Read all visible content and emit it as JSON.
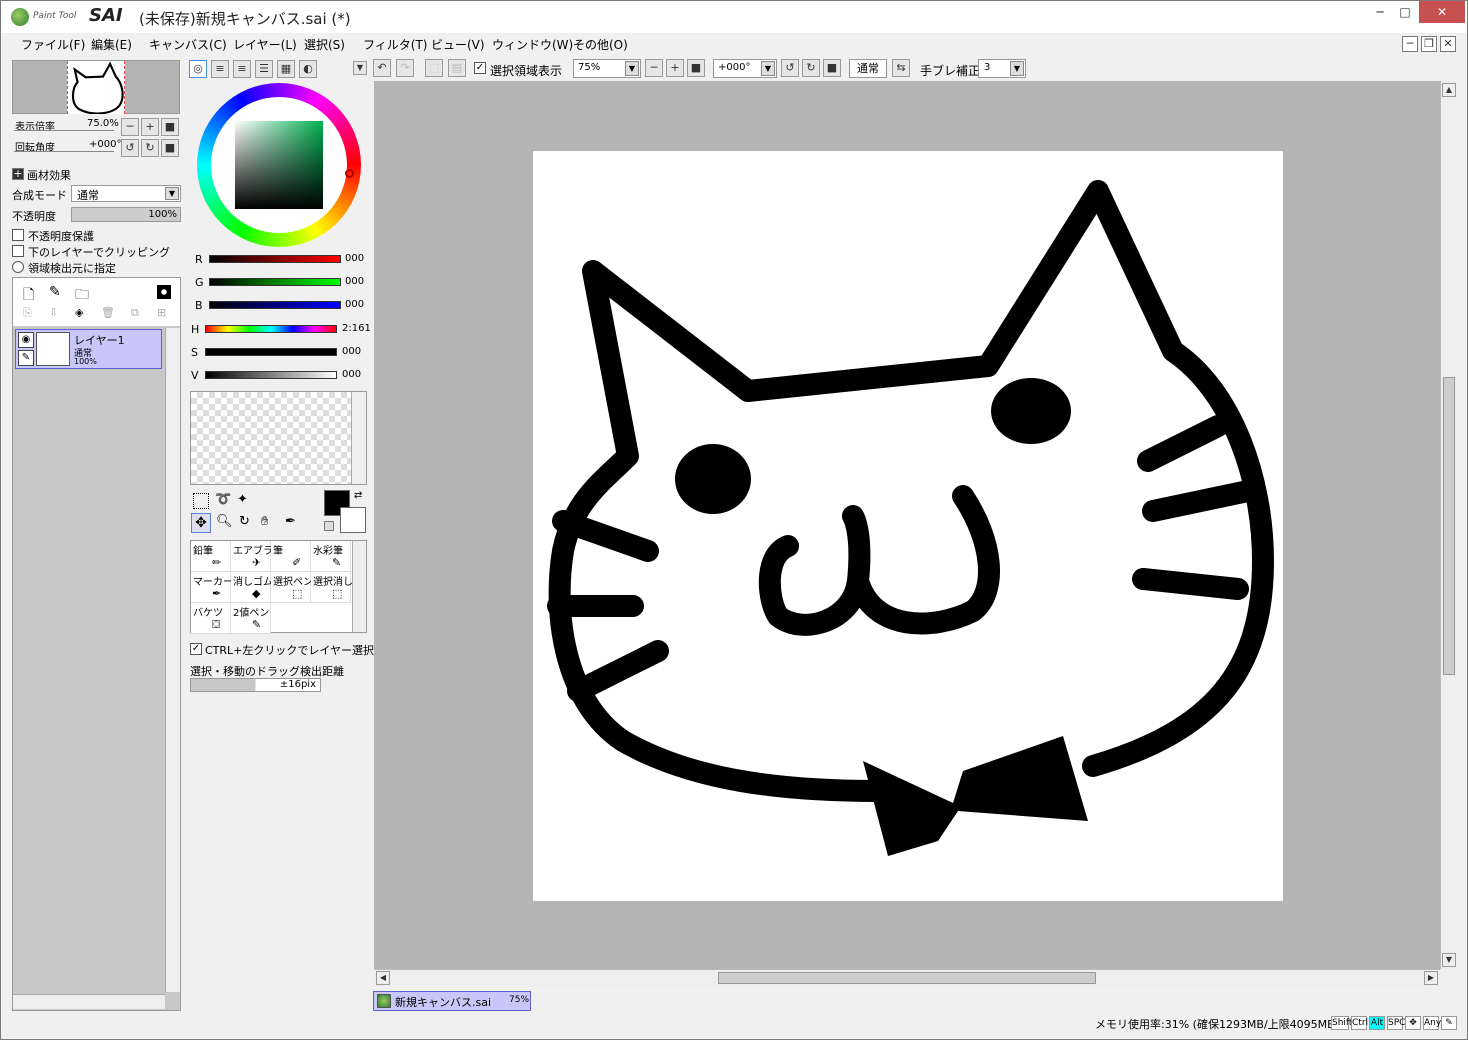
{
  "window": {
    "title": "(未保存)新規キャンバス.sai (*)",
    "logo_small": "Paint Tool",
    "logo_big": "SAI",
    "minimize": "─",
    "maximize": "□",
    "close": "✕"
  },
  "menu": [
    "ファイル(F)",
    "編集(E)",
    "キャンバス(C)",
    "レイヤー(L)",
    "選択(S)",
    "フィルタ(T)",
    "ビュー(V)",
    "ウィンドウ(W)",
    "その他(O)"
  ],
  "navigator": {
    "zoom_label": "表示倍率",
    "zoom_value": "75.0%",
    "rotate_label": "回転角度",
    "rotate_value": "+000°"
  },
  "layer_props": {
    "section": "画材効果",
    "blend_label": "合成モード",
    "blend_value": "通常",
    "opacity_label": "不透明度",
    "opacity_value": "100%",
    "protect_opacity": "不透明度保護",
    "clip_lower": "下のレイヤーでクリッピング",
    "region_source": "領域検出元に指定"
  },
  "layers": [
    {
      "name": "レイヤー1",
      "mode": "通常",
      "opacity": "100%"
    }
  ],
  "color": {
    "rgb": [
      {
        "label": "R",
        "value": "000"
      },
      {
        "label": "G",
        "value": "000"
      },
      {
        "label": "B",
        "value": "000"
      }
    ],
    "hsv": [
      {
        "label": "H",
        "value": "2:161"
      },
      {
        "label": "S",
        "value": "000"
      },
      {
        "label": "V",
        "value": "000"
      }
    ],
    "fg": "#000000",
    "bg": "#ffffff"
  },
  "tools": [
    [
      "鉛筆",
      "エアブラシ",
      "筆",
      "水彩筆"
    ],
    [
      "マーカー",
      "消しゴム",
      "選択ペン",
      "選択消し"
    ],
    [
      "バケツ",
      "2値ペン"
    ]
  ],
  "tool_options": {
    "ctrl_select": "CTRL+左クリックでレイヤー選択",
    "drag_distance_label": "選択・移動のドラッグ検出距離",
    "drag_distance_value": "±16pix"
  },
  "toolbar": {
    "show_selection": "選択領域表示",
    "zoom": "75%",
    "rotation": "+000°",
    "mode": "通常",
    "stabilizer_label": "手ブレ補正",
    "stabilizer_value": "3"
  },
  "tab": {
    "name": "新規キャンバス.sai",
    "zoom": "75%"
  },
  "status": {
    "memory": "メモリ使用率:31% (確保1293MB/上限4095MB)",
    "keys": [
      "Shift",
      "Ctrl",
      "Alt",
      "SPC",
      "Any"
    ]
  },
  "colors": {
    "accent": "#0078d7",
    "active_key": "#00ffff",
    "canvas_bg": "#b4b4b4",
    "layer_sel": "#c8c8f8"
  }
}
